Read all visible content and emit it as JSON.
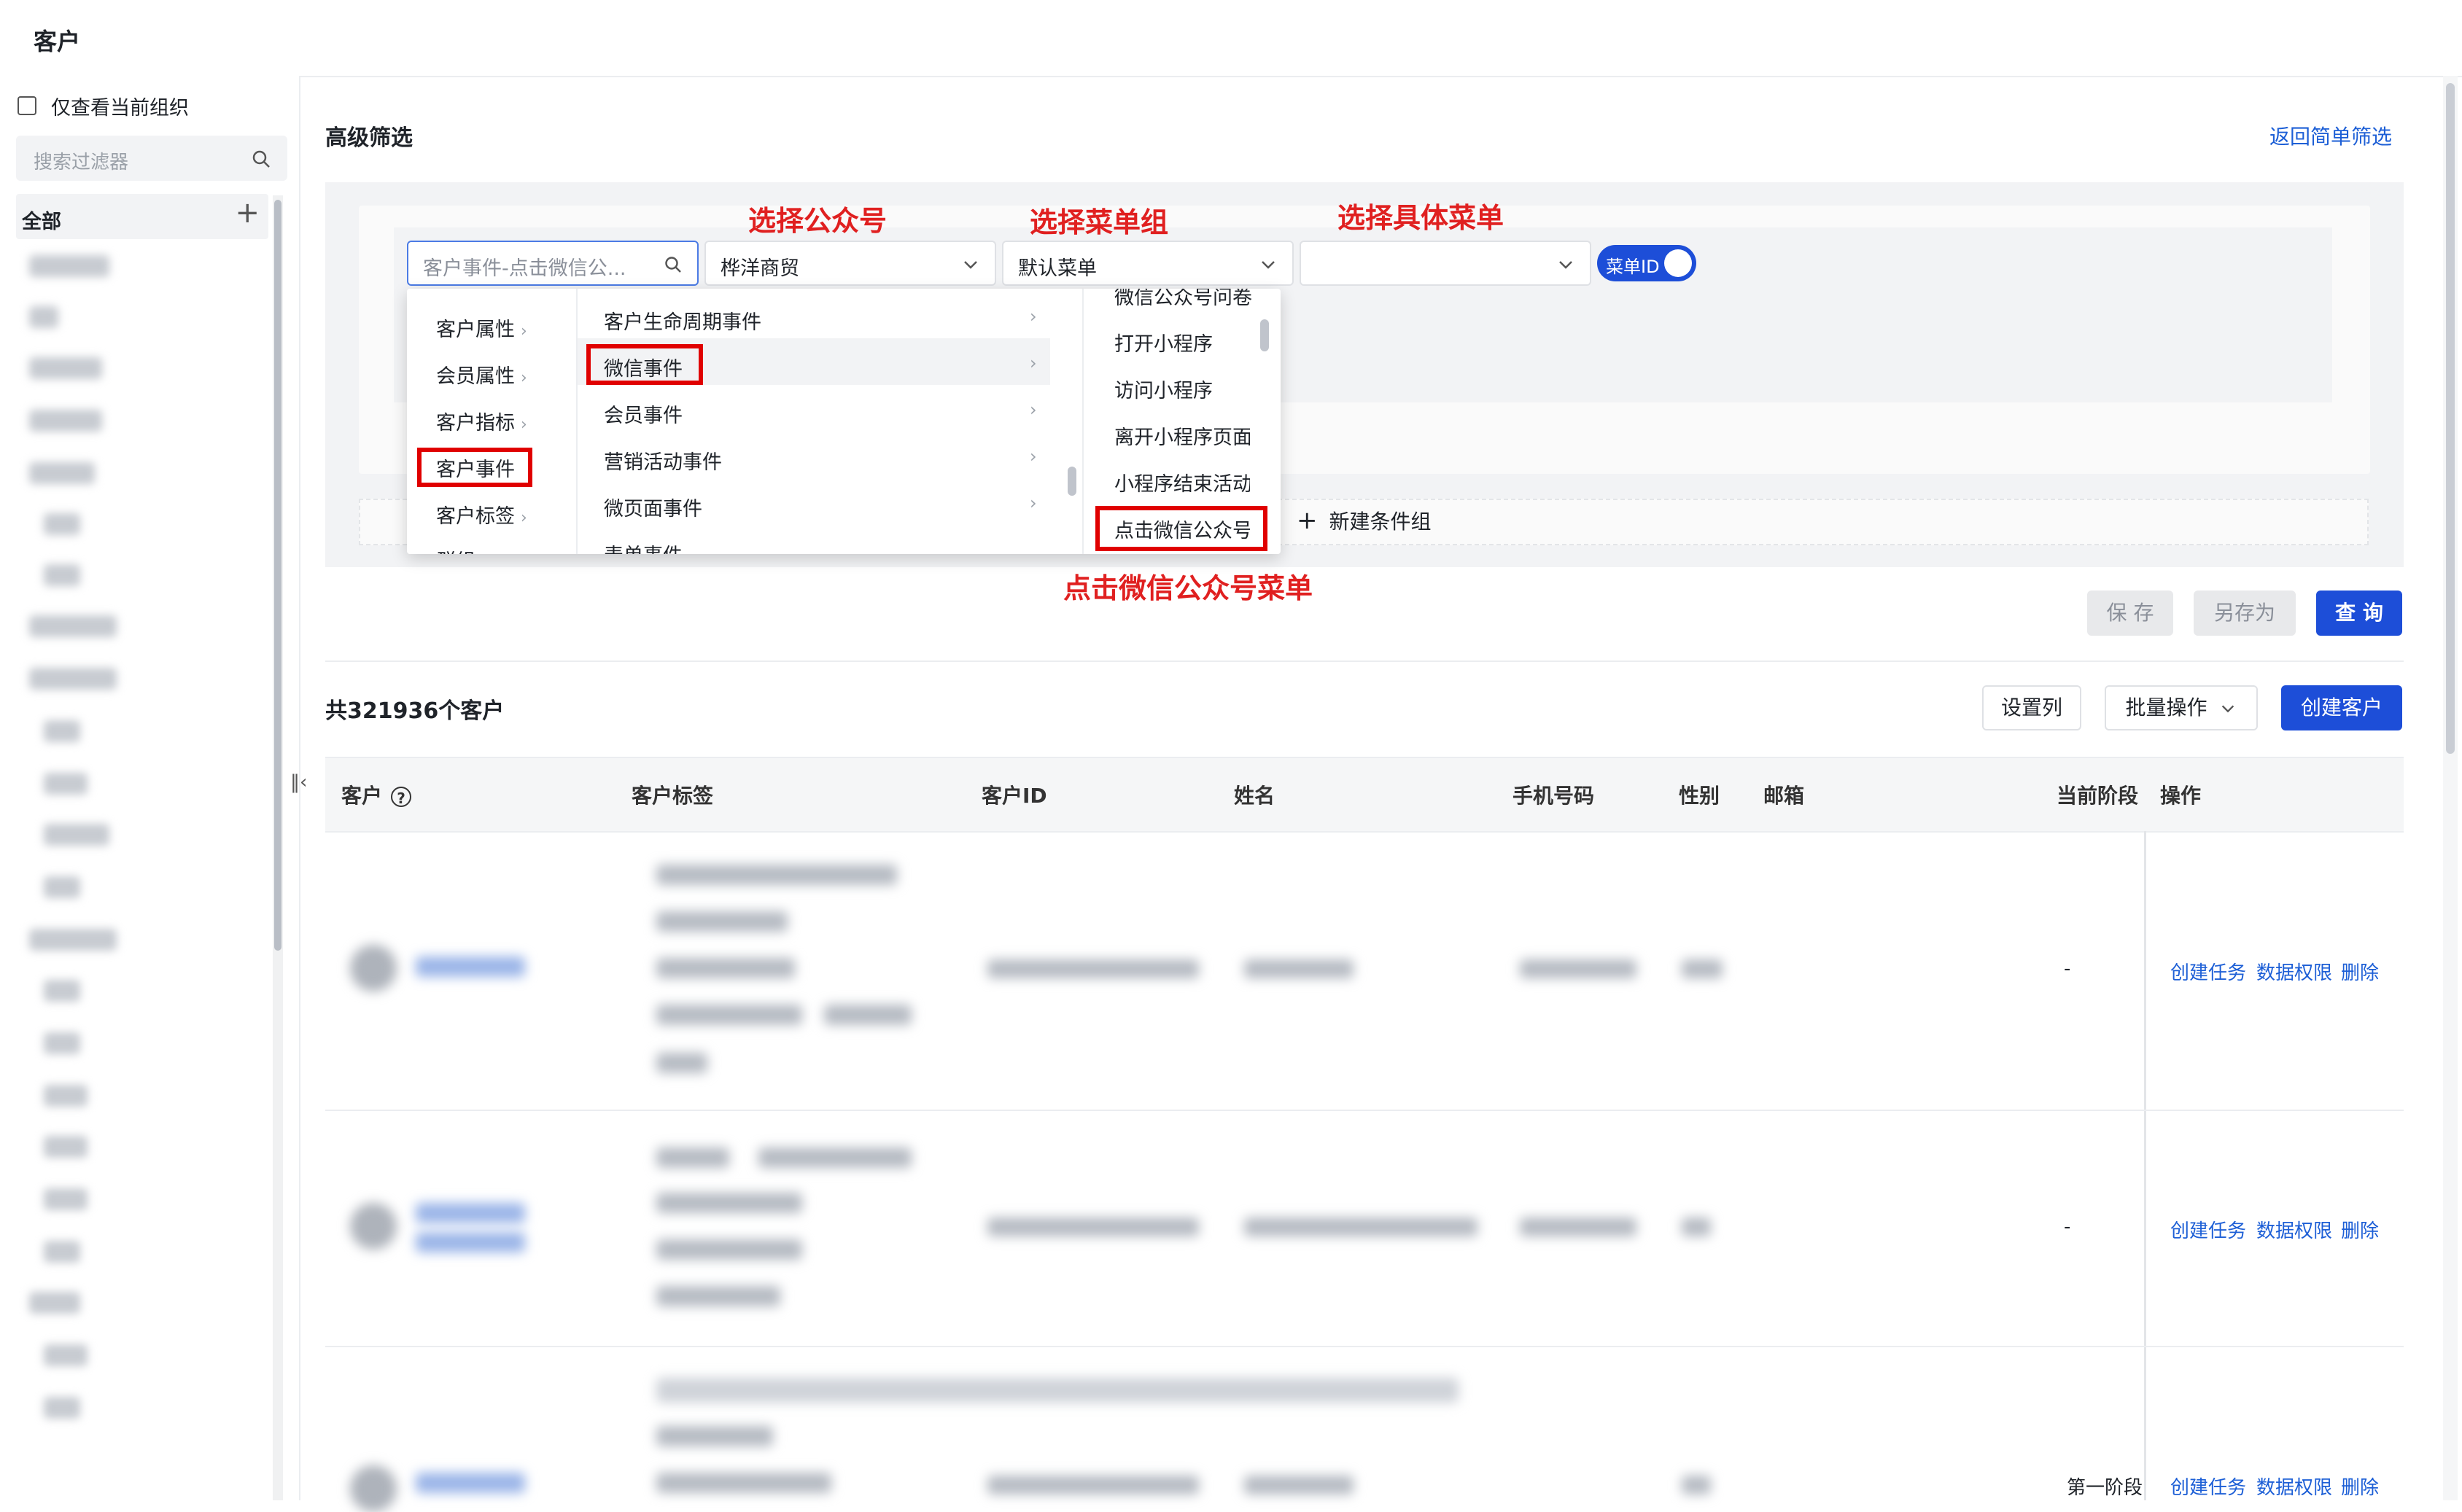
{
  "page": {
    "title": "客户"
  },
  "sidebar": {
    "only_current_org_label": "仅查看当前组织",
    "search_placeholder": "搜索过滤器",
    "all_label": "全部",
    "add_symbol": "+"
  },
  "filter": {
    "section_title": "高级筛选",
    "back_link": "返回简单筛选",
    "event_select": "客户事件-点击微信公...",
    "account_select": "桦洋商贸",
    "menu_group_select": "默认菜单",
    "menu_select": "",
    "toggle_label": "菜单ID",
    "new_group_label": "新建条件组",
    "annotations": {
      "select_account": "选择公众号",
      "select_menu_group": "选择菜单组",
      "select_menu": "选择具体菜单",
      "click_menu": "点击微信公众号菜单"
    },
    "dropdown": {
      "col1": [
        "客户属性",
        "会员属性",
        "客户指标",
        "客户事件",
        "客户标签",
        "群组"
      ],
      "col2": [
        "客户生命周期事件",
        "微信事件",
        "会员事件",
        "营销活动事件",
        "微页面事件",
        "表单事件"
      ],
      "col3": [
        "微信公众号问卷",
        "打开小程序",
        "访问小程序",
        "离开小程序页面",
        "小程序结束活动",
        "点击微信公众号"
      ]
    }
  },
  "actions": {
    "save": "保 存",
    "save_as": "另存为",
    "query": "查 询"
  },
  "table": {
    "total_text": "共321936个客户",
    "settings_btn": "设置列",
    "batch_btn": "批量操作",
    "create_btn": "创建客户",
    "columns": [
      "客户",
      "客户标签",
      "客户ID",
      "姓名",
      "手机号码",
      "性别",
      "邮箱",
      "当前阶段",
      "操作"
    ],
    "rows": [
      {
        "stage": "-",
        "ops": [
          "创建任务",
          "数据权限",
          "删除"
        ]
      },
      {
        "stage": "-",
        "ops": [
          "创建任务",
          "数据权限",
          "删除"
        ]
      },
      {
        "stage": "第一阶段",
        "ops": [
          "创建任务",
          "数据权限",
          "删除"
        ]
      }
    ]
  }
}
